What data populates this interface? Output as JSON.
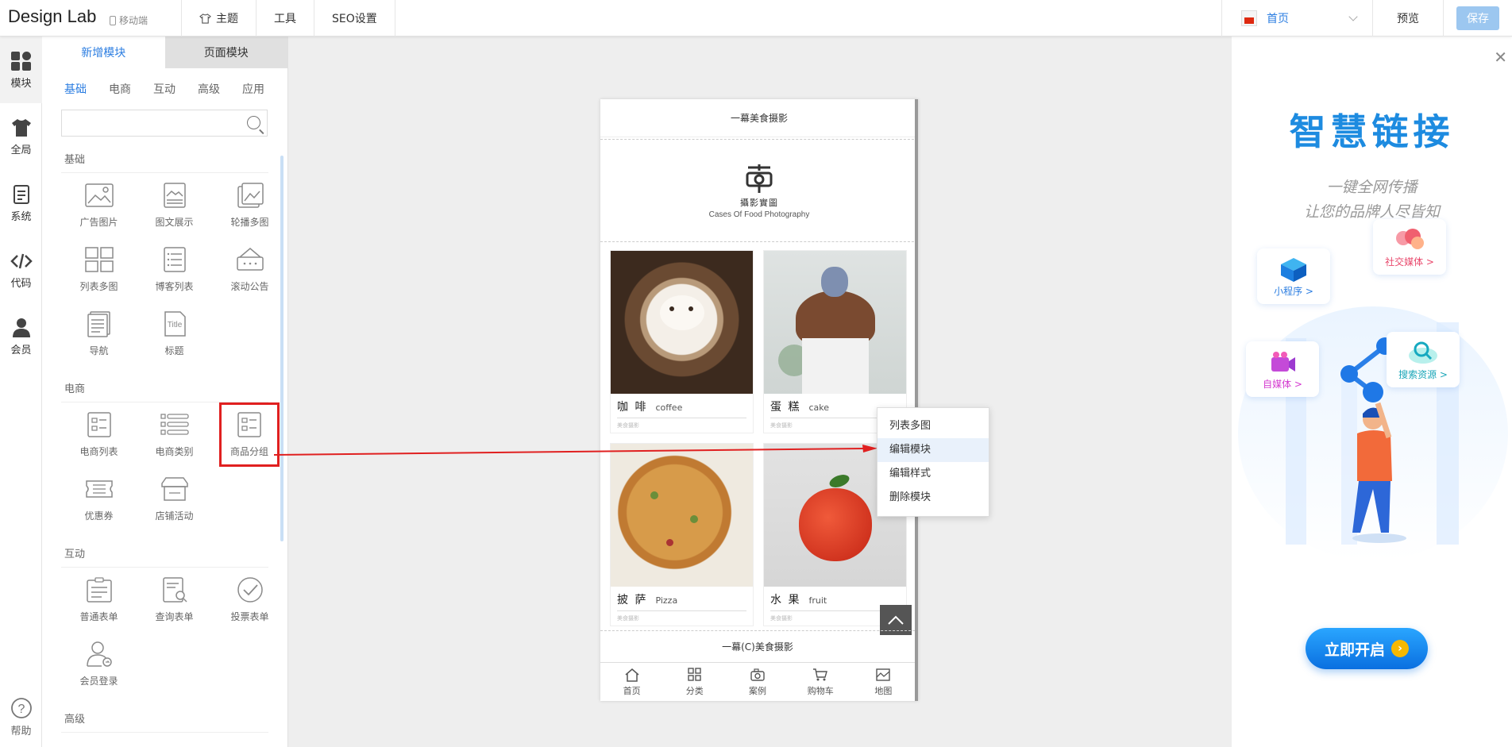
{
  "header": {
    "brand": "Design Lab",
    "mobile_label": "移动端",
    "nav": [
      {
        "label": "主题",
        "icon": "shirt-icon"
      },
      {
        "label": "工具"
      },
      {
        "label": "SEO设置"
      }
    ],
    "page_select": "首页",
    "preview_label": "预览",
    "save_label": "保存"
  },
  "rail": {
    "items": [
      {
        "label": "模块",
        "icon": "modules-icon"
      },
      {
        "label": "全局",
        "icon": "shirt-icon"
      },
      {
        "label": "系统",
        "icon": "document-icon"
      },
      {
        "label": "代码",
        "icon": "code-icon"
      },
      {
        "label": "会员",
        "icon": "user-icon"
      }
    ],
    "help_label": "帮助"
  },
  "panel": {
    "tabs": [
      "新增模块",
      "页面模块"
    ],
    "categories": [
      "基础",
      "电商",
      "互动",
      "高级",
      "应用"
    ],
    "search_placeholder": "",
    "sections": [
      {
        "title": "基础",
        "items": [
          "广告图片",
          "图文展示",
          "轮播多图",
          "列表多图",
          "博客列表",
          "滚动公告",
          "导航",
          "标题"
        ]
      },
      {
        "title": "电商",
        "items": [
          "电商列表",
          "电商类别",
          "商品分组",
          "优惠券",
          "店铺活动"
        ]
      },
      {
        "title": "互动",
        "items": [
          "普通表单",
          "查询表单",
          "投票表单",
          "会员登录"
        ]
      },
      {
        "title": "高级",
        "items": []
      }
    ]
  },
  "phone": {
    "header": "一幕美食摄影",
    "logo_cn": "攝影實圖",
    "logo_en": "Cases Of Food Photography",
    "cards": [
      {
        "cn": "咖 啡",
        "en": "coffee",
        "sub": "美食摄影"
      },
      {
        "cn": "蛋 糕",
        "en": "cake",
        "sub": "美食摄影"
      },
      {
        "cn": "披 萨",
        "en": "Pizza",
        "sub": "美食摄影"
      },
      {
        "cn": "水 果",
        "en": "fruit",
        "sub": "美食摄影"
      }
    ],
    "footer": "一幕(C)美食摄影",
    "nav": [
      "首页",
      "分类",
      "案例",
      "购物车",
      "地图"
    ]
  },
  "context_menu": {
    "items": [
      "列表多图",
      "编辑模块",
      "编辑样式",
      "删除模块"
    ],
    "hovered_index": 1
  },
  "promo": {
    "title": "智慧链接",
    "subtitle_1": "一键全网传播",
    "subtitle_2": "让您的品牌人尽皆知",
    "tags": [
      "小程序 >",
      "社交媒体 >",
      "自媒体 >",
      "搜索资源 >"
    ],
    "cta": "立即开启"
  },
  "colors": {
    "accent": "#2b7de1",
    "highlight_red": "#e02020",
    "save_button": "#9cc7f0"
  }
}
